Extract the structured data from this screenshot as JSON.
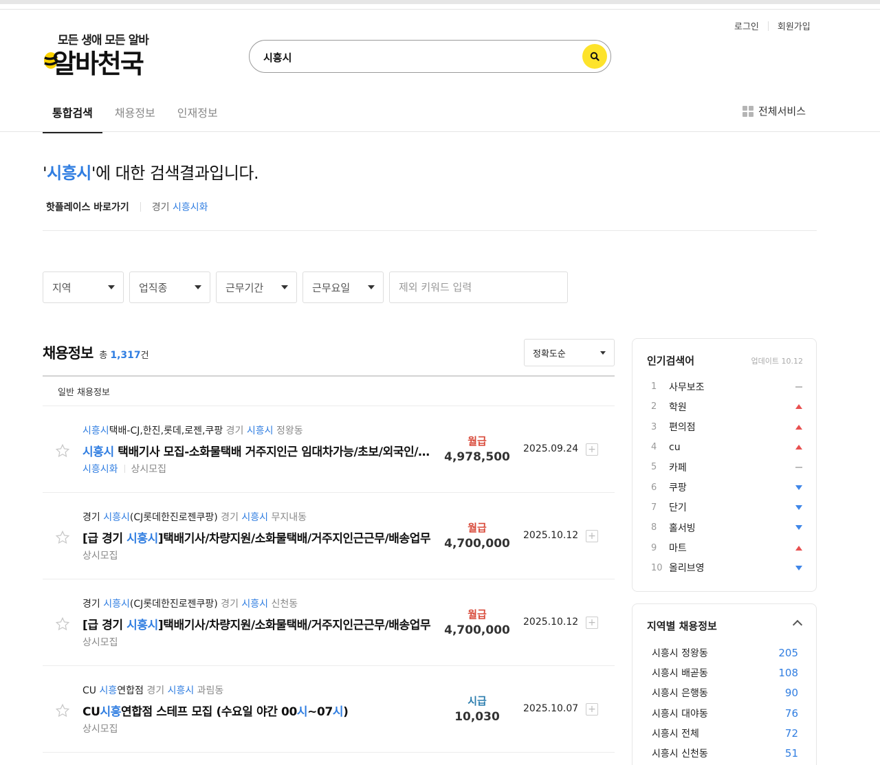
{
  "header": {
    "login": "로그인",
    "signup": "회원가입",
    "logo_tagline": "모든 생애 모든 알바",
    "logo_name": "알바천국",
    "search_value": "시흥시"
  },
  "tabs": [
    {
      "label": "통합검색",
      "active": true
    },
    {
      "label": "채용정보",
      "active": false
    },
    {
      "label": "인재정보",
      "active": false
    }
  ],
  "all_services": "전체서비스",
  "result": {
    "quote_open": "'",
    "keyword": "시흥시",
    "suffix": "'에 대한 검색결과입니다.",
    "hotplace_label": "핫플레이스 바로가기",
    "hotplace_prefix": "경기 ",
    "hotplace_link": "시흥시화"
  },
  "filters": {
    "region": "지역",
    "category": "업직종",
    "period": "근무기간",
    "days": "근무요일",
    "exclude_placeholder": "제외 키워드 입력"
  },
  "list": {
    "title": "채용정보",
    "total_prefix": "총 ",
    "total_count": "1,317",
    "total_suffix": "건",
    "sort": "정확도순",
    "section_label": "일반 채용정보"
  },
  "jobs": [
    {
      "company_a": "시흥시",
      "company_b": "택배-CJ,한진,롯데,로젠,쿠팡",
      "loc_a": " 경기 ",
      "loc_b": "시흥시",
      "loc_c": " 정왕동",
      "title_a": "시흥시",
      "title_b": " 택배기사 모집-소화물택배 거주지인근 임대차가능/초보/외국인/여성 가능",
      "meta_a": "시흥시화",
      "meta_b": "상시모집",
      "pay_type": "월급",
      "pay_amount": "4,978,500",
      "date": "2025.09.24"
    },
    {
      "company_a": "경기 ",
      "company_b": "시흥시",
      "company_c": "(CJ롯데한진로젠쿠팡)",
      "loc_a": " 경기 ",
      "loc_b": "시흥시",
      "loc_c": " 무지내동",
      "title_a": "[급 경기 ",
      "title_b": "시흥시",
      "title_c": "]택배기사/차량지원/소화물택배/거주지인근근무/배송업무",
      "meta_a": "상시모집",
      "pay_type": "월급",
      "pay_amount": "4,700,000",
      "date": "2025.10.12"
    },
    {
      "company_a": "경기 ",
      "company_b": "시흥시",
      "company_c": "(CJ롯데한진로젠쿠팡)",
      "loc_a": " 경기 ",
      "loc_b": "시흥시",
      "loc_c": " 신천동",
      "title_a": "[급 경기 ",
      "title_b": "시흥시",
      "title_c": "]택배기사/차량지원/소화물택배/거주지인근근무/배송업무",
      "meta_a": "상시모집",
      "pay_type": "월급",
      "pay_amount": "4,700,000",
      "date": "2025.10.12"
    },
    {
      "company_a": "CU ",
      "company_b": "시흥",
      "company_c": "연합점",
      "loc_a": " 경기 ",
      "loc_b": "시흥시",
      "loc_c": " 과림동",
      "title_a": "CU",
      "title_b": "시흥",
      "title_c": "연합점 스테프 모집 (수요일 야간 00",
      "title_d": "시",
      "title_e": "~07",
      "title_f": "시",
      "title_g": ")",
      "meta_a": "상시모집",
      "pay_type": "시급",
      "pay_amount": "10,030",
      "date": "2025.10.07"
    }
  ],
  "popular": {
    "title": "인기검색어",
    "updated": "업데이트 10.12",
    "items": [
      {
        "rank": "1",
        "keyword": "사무보조",
        "trend": "same"
      },
      {
        "rank": "2",
        "keyword": "학원",
        "trend": "up"
      },
      {
        "rank": "3",
        "keyword": "편의점",
        "trend": "up"
      },
      {
        "rank": "4",
        "keyword": "cu",
        "trend": "up"
      },
      {
        "rank": "5",
        "keyword": "카페",
        "trend": "same"
      },
      {
        "rank": "6",
        "keyword": "쿠팡",
        "trend": "down"
      },
      {
        "rank": "7",
        "keyword": "단기",
        "trend": "down"
      },
      {
        "rank": "8",
        "keyword": "홀서빙",
        "trend": "down"
      },
      {
        "rank": "9",
        "keyword": "마트",
        "trend": "up"
      },
      {
        "rank": "10",
        "keyword": "올리브영",
        "trend": "down"
      }
    ]
  },
  "regions": {
    "title": "지역별 채용정보",
    "items": [
      {
        "name": "시흥시 정왕동",
        "count": "205"
      },
      {
        "name": "시흥시 배곧동",
        "count": "108"
      },
      {
        "name": "시흥시 은행동",
        "count": "90"
      },
      {
        "name": "시흥시 대야동",
        "count": "76"
      },
      {
        "name": "시흥시 전체",
        "count": "72"
      },
      {
        "name": "시흥시 신천동",
        "count": "51"
      }
    ]
  },
  "colors": {
    "accent_blue": "#2f7de1",
    "brand_yellow": "#fde32b",
    "monthly_pay_red": "#d84a3a",
    "hourly_pay_teal": "#2c7dae"
  }
}
